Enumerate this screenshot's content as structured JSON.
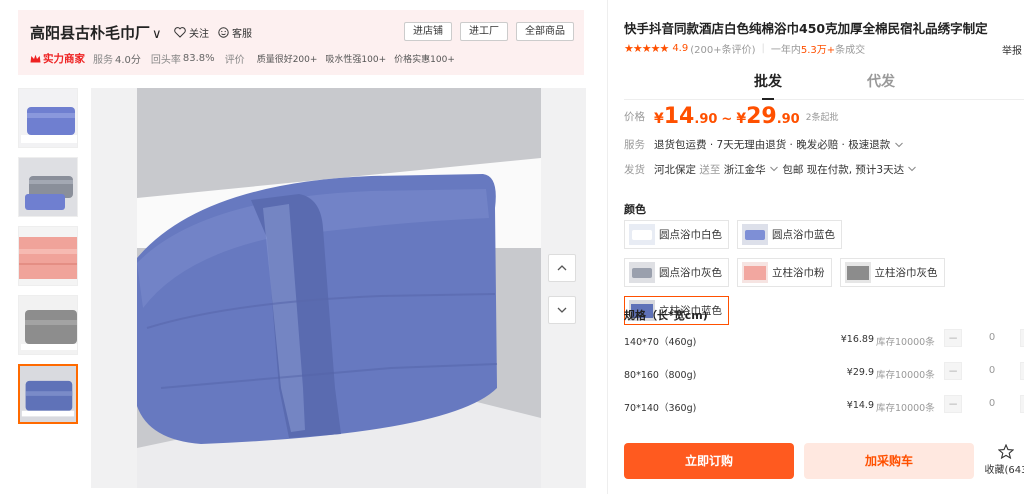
{
  "shop": {
    "name": "高阳县古朴毛巾厂",
    "follow_label": "关注",
    "service_label": "客服",
    "buttons": [
      "进店铺",
      "进工厂",
      "全部商品"
    ],
    "badge": "实力商家",
    "service_score_label": "服务",
    "service_score": "4.0分",
    "return_rate_label": "回头率",
    "return_rate": "83.8%",
    "review_label": "评价",
    "review_tags": [
      "质量很好200+",
      "吸水性强100+",
      "价格实惠100+"
    ]
  },
  "gallery": {
    "thumbnails": [
      {
        "name": "thumb-blue-towel-1",
        "color": "#6f7fd0"
      },
      {
        "name": "thumb-gray-towel-stack",
        "color": "#8a8f9a"
      },
      {
        "name": "thumb-pink-towel",
        "color": "#f0a39a"
      },
      {
        "name": "thumb-gray-towel",
        "color": "#8d8d8d"
      },
      {
        "name": "thumb-blue-towel-2",
        "color": "#5f72b8"
      }
    ],
    "active_index": 4
  },
  "product": {
    "title": "快手抖音同款酒店白色纯棉浴巾450克加厚全棉民宿礼品绣字制定",
    "rating": "4.9",
    "reviews": "(200+条评价)",
    "sales_prefix": "一年内",
    "sales_value": "5.3万+",
    "sales_suffix": "条成交",
    "report": "举报"
  },
  "tabs": [
    "批发",
    "代发"
  ],
  "price": {
    "label": "价格",
    "low_int": "14",
    "low_dec": ".90",
    "high_int": "29",
    "high_dec": ".90",
    "currency": "¥",
    "tilde": "~",
    "min_order": "2条起批"
  },
  "service": {
    "label": "服务",
    "text": "退货包运费 · 7天无理由退货 · 晚发必赔 · 极速退款"
  },
  "shipping": {
    "label": "发货",
    "from": "河北保定",
    "to_label": "送至",
    "to": "浙江金华",
    "free": "包邮",
    "pay_now": "现在付款,",
    "eta": "预计3天达"
  },
  "colors": {
    "title": "颜色",
    "options": [
      {
        "label": "圆点浴巾白色",
        "swatch": "#e8ecf4"
      },
      {
        "label": "圆点浴巾蓝色",
        "swatch": "#7e8fd6"
      },
      {
        "label": "圆点浴巾灰色",
        "swatch": "#9aa0ad"
      },
      {
        "label": "立柱浴巾粉",
        "swatch": "#f2a7a0"
      },
      {
        "label": "立柱浴巾灰色",
        "swatch": "#8c8c8c"
      },
      {
        "label": "立柱浴巾蓝色",
        "swatch": "#5f72b8"
      }
    ],
    "selected_index": 5
  },
  "specs": {
    "title": "规格（长*宽cm)",
    "rows": [
      {
        "name": "140*70（460g)",
        "price": "¥16.89",
        "stock": "库存10000条",
        "qty": "0"
      },
      {
        "name": "80*160（800g)",
        "price": "¥29.9",
        "stock": "库存10000条",
        "qty": "0"
      },
      {
        "name": "70*140（360g)",
        "price": "¥14.9",
        "stock": "库存10000条",
        "qty": "0"
      }
    ]
  },
  "actions": {
    "order": "立即订购",
    "cart": "加采购车",
    "favorite": "收藏(643"
  },
  "theme": {
    "accent": "#ff5000",
    "shop_bg": "#fdf0f0"
  }
}
